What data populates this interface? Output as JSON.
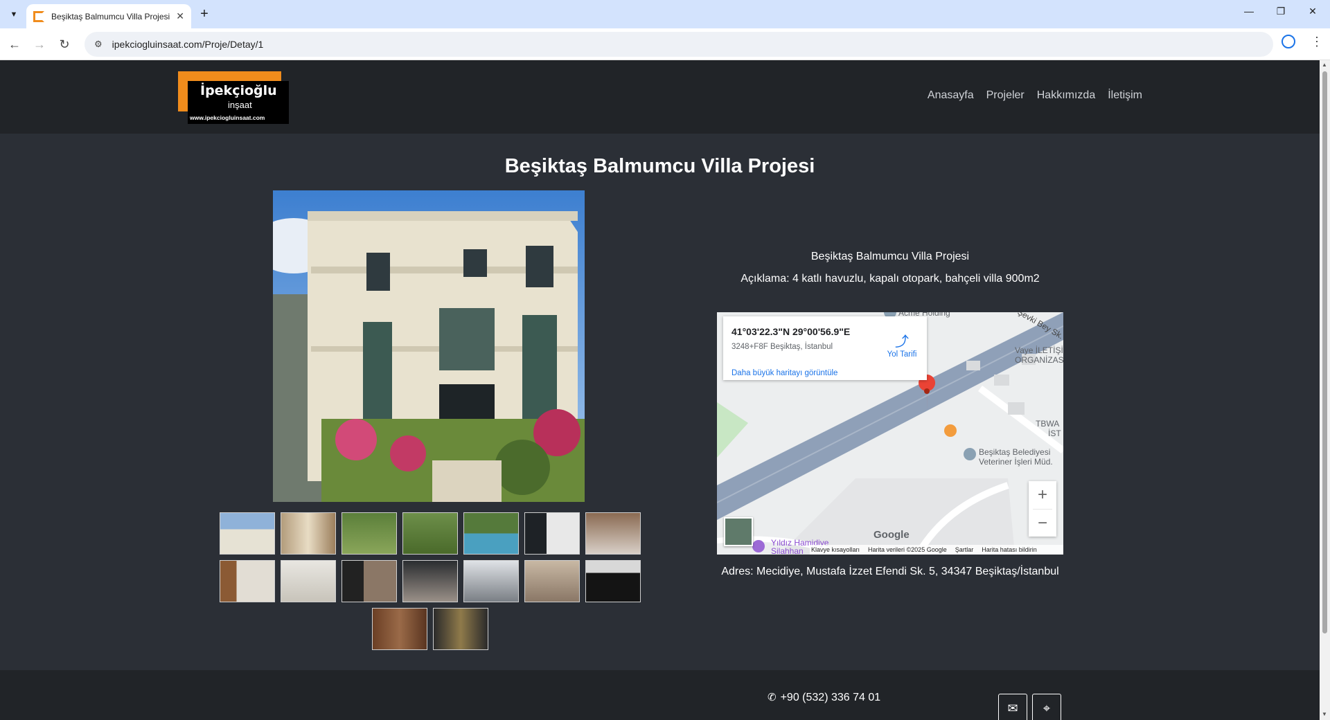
{
  "browser": {
    "tab_title": "Beşiktaş Balmumcu Villa Projesi",
    "url": "ipekciogluinsaat.com/Proje/Detay/1"
  },
  "site": {
    "brand": "İpekçioğlu",
    "brand_sub": "inşaat",
    "brand_url": "www.ipekciogluinsaat.com",
    "nav": [
      "Anasayfa",
      "Projeler",
      "Hakkımızda",
      "İletişim"
    ]
  },
  "project": {
    "title": "Beşiktaş Balmumcu Villa Projesi",
    "name": "Beşiktaş Balmumcu Villa Projesi",
    "description": "Açıklama: 4 katlı havuzlu, kapalı otopark, bahçeli villa 900m2",
    "address": "Adres: Mecidiye, Mustafa İzzet Efendi Sk. 5, 34347 Beşiktaş/İstanbul"
  },
  "map": {
    "coords": "41°03'22.3\"N 29°00'56.9\"E",
    "plus_code": "3248+F8F Beşiktaş, İstanbul",
    "directions": "Yol Tarifi",
    "bigger_map": "Daha büyük haritayı görüntüle",
    "labels": {
      "acme": "Acme Holding",
      "street": "Şevki Bey Sk.",
      "vaye1": "Vaye İLETİŞİM",
      "vaye2": "ORGANİZASYON",
      "tbwa1": "TBWA",
      "tbwa2": "İST",
      "bel1": "Beşiktaş Belediyesi",
      "bel2": "Veteriner İşleri Müd.",
      "yildiz": "Yıldız Hamidiye",
      "yildiz2": "Silahhan"
    },
    "google": "Google",
    "footer": [
      "Klavye kısayolları",
      "Harita verileri ©2025 Google",
      "Şartlar",
      "Harita hatası bildirin"
    ]
  },
  "footer": {
    "phone": "+90 (532) 336 74 01"
  },
  "icons": {
    "phone": "phone-icon",
    "mail": "envelope-icon",
    "location": "map-pin-icon"
  },
  "colors": {
    "brand_orange": "#f08c1c",
    "page_bg": "#2b2f36",
    "header_bg": "#212428"
  }
}
